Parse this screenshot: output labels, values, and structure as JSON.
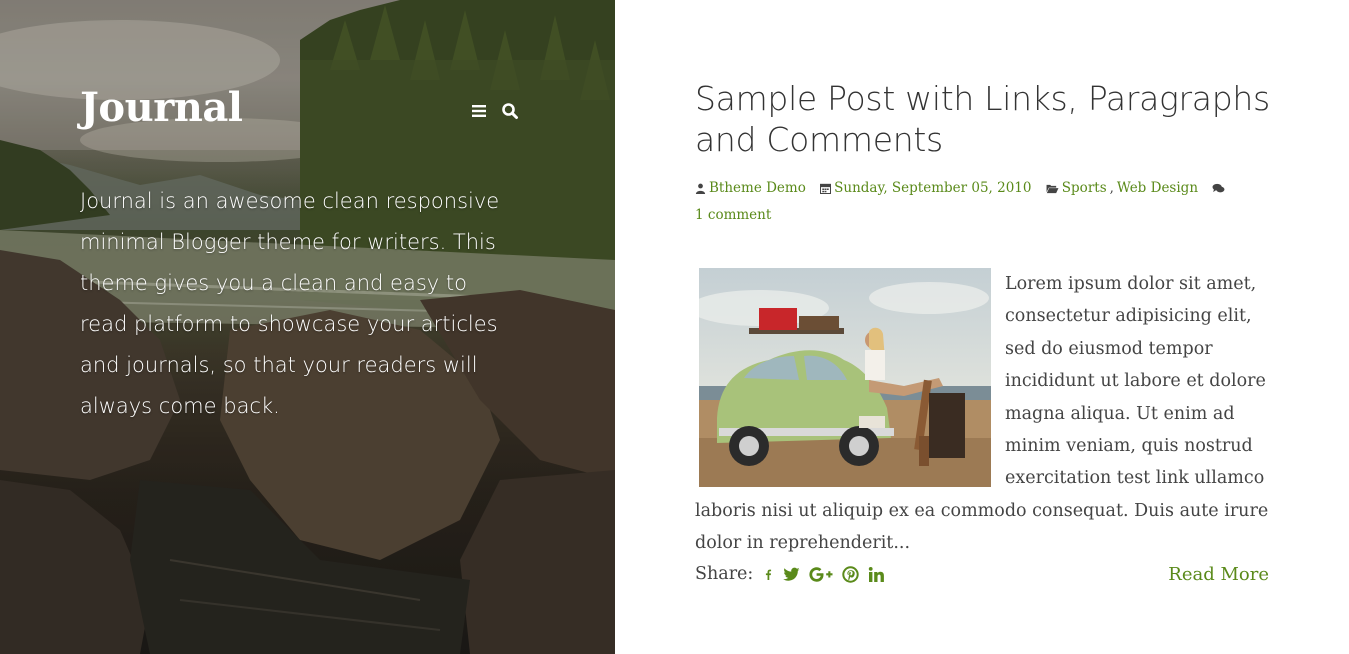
{
  "hero": {
    "site_title": "Journal",
    "description": "Journal is an awesome clean responsive minimal Blogger theme for writers. This theme gives you a clean and easy to read platform to showcase your articles and journals, so that your readers will always come back.",
    "icons": [
      "menu-icon",
      "search-icon"
    ]
  },
  "post": {
    "title": "Sample Post with Links, Paragraphs and Comments",
    "meta": {
      "author": "Btheme Demo",
      "date": "Sunday, September 05, 2010",
      "category_1": "Sports",
      "category_sep": ",",
      "category_2": "Web Design",
      "comments": "1 comment"
    },
    "excerpt": "Lorem ipsum dolor sit amet, consectetur adipisicing elit, sed do eiusmod tempor incididunt ut labore et dolore magna aliqua. Ut enim ad minim veniam, quis nostrud exercitation test link ullamco laboris nisi ut aliquip ex ea commodo consequat. Duis aute irure dolor in reprehenderit...",
    "share_label": "Share:",
    "share_icons": [
      "facebook-icon",
      "twitter-icon",
      "google-plus-icon",
      "pinterest-icon",
      "linkedin-icon"
    ],
    "read_more": "Read More"
  },
  "colors": {
    "accent": "#5a8a1a",
    "text": "#444444",
    "title": "#333333"
  }
}
